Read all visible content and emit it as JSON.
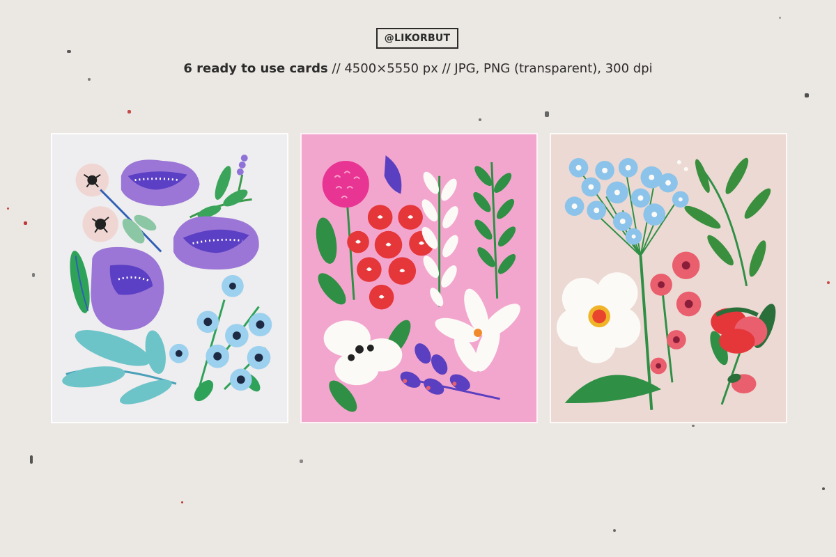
{
  "header": {
    "brand": "@LIKORBUT",
    "subtitle_bold": "6 ready to use cards",
    "subtitle_rest": " // 4500×5550 px // JPG, PNG (transparent), 300 dpi"
  },
  "cards": [
    {
      "id": "purple-blue-floral-card",
      "background": "#eeedef"
    },
    {
      "id": "pink-red-floral-card",
      "background": "#f3a6cd"
    },
    {
      "id": "blush-blue-white-floral-card",
      "background": "#ecd9d3"
    }
  ],
  "colors": {
    "paper": "#ebe7e2",
    "purple": "#9b76d6",
    "light_blue": "#8cc3ea",
    "teal": "#6cc4c9",
    "green": "#3c9a4c",
    "red": "#e5363a",
    "magenta": "#e83593",
    "indigo": "#5a3fc0",
    "white": "#fbfaf6",
    "coral": "#ea5f6e"
  }
}
